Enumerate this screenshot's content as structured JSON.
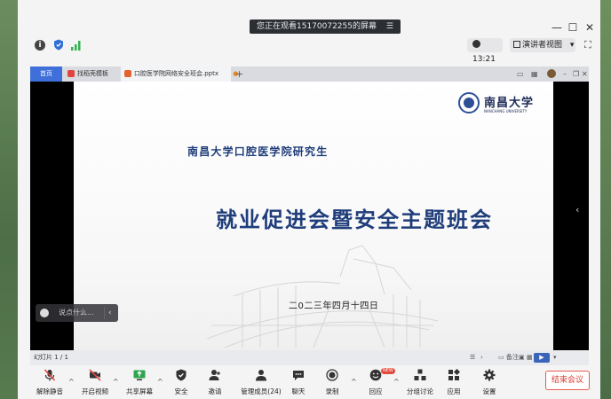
{
  "screen_share": {
    "banner": "您正在观看15170072255的屏幕",
    "banner_menu_icon": "menu-icon"
  },
  "window_controls": {
    "minimize": "—",
    "maximize": "☐",
    "close": "✕"
  },
  "status_bar": {
    "meeting_time": "13:21",
    "view_mode": "演讲者视图",
    "view_caret": "▾",
    "fullscreen": "⛶"
  },
  "ppt": {
    "home_tab": "首页",
    "tabs": [
      {
        "label": "找稻壳模板",
        "icon_color": "#e0463d"
      },
      {
        "label": "口腔医学院网络安全班会.pptx",
        "icon_color": "#e2632f"
      }
    ],
    "modified_dot": "●",
    "new_tab": "+",
    "slide": {
      "logo_cn": "南昌大学",
      "logo_en": "NANCHANG UNIVERSITY",
      "subtitle": "南昌大学口腔医学院研究生",
      "title": "就业促进会暨安全主题班会",
      "date": "二0二三年四月十四日"
    },
    "status": {
      "page_indicator": "幻灯片 1 / 1",
      "notes_label": "备注",
      "play_label": "▶"
    }
  },
  "chat": {
    "placeholder": "说点什么...",
    "collapse": "‹"
  },
  "toolbar": {
    "items": [
      {
        "label": "解除静音"
      },
      {
        "label": "开启视频"
      },
      {
        "label": "共享屏幕"
      },
      {
        "label": "安全"
      },
      {
        "label": "邀请"
      },
      {
        "label": "管理成员(24)"
      },
      {
        "label": "聊天"
      },
      {
        "label": "录制"
      },
      {
        "label": "回应"
      },
      {
        "label": "分组讨论"
      },
      {
        "label": "应用"
      },
      {
        "label": "设置"
      }
    ],
    "new_badge": "NEW",
    "end_meeting": "结束会议",
    "colors": {
      "end": "#d83b30",
      "mute_slash": "#e0463d",
      "share_green": "#2fa44f"
    }
  }
}
